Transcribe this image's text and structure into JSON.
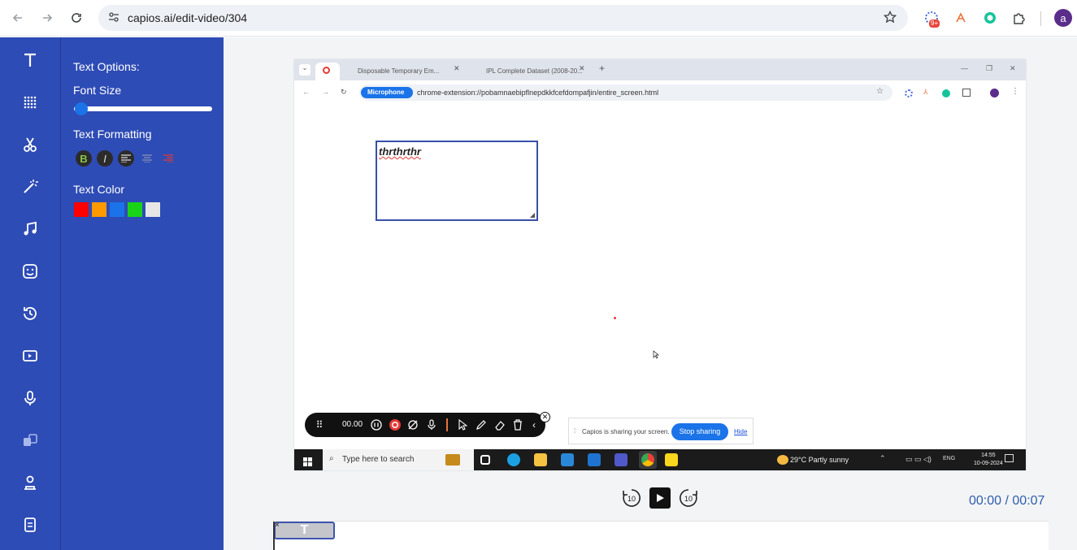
{
  "browser": {
    "url": "capios.ai/edit-video/304",
    "extension_badge": "9+",
    "avatar_letter": "a"
  },
  "rail": {
    "items": [
      "text-tool",
      "blur-tool",
      "cut-tool",
      "effects-tool",
      "music-tool",
      "sticker-tool",
      "speed-tool",
      "media-tool",
      "voice-tool",
      "transition-tool",
      "avatar-tool",
      "export-tool"
    ]
  },
  "panel": {
    "title": "Text Options:",
    "font_size_label": "Font Size",
    "font_size_level": 0.05,
    "formatting_label": "Text Formatting",
    "bold_label": "B",
    "italic_label": "I",
    "color_label": "Text Color",
    "colors": [
      "#ff0000",
      "#ff9900",
      "#1a73e8",
      "#19d319",
      "#e6e6e6"
    ]
  },
  "video": {
    "tab1": "Disposable Temporary Em...",
    "tab2": "IPL Complete Dataset (2008-20...",
    "mic_chip": "Microphone",
    "inner_url": "chrome-extension://pobamnaebipflnepdkkfcefdompafjin/entire_screen.html",
    "textbox_text": "thrthrthr",
    "timer": "00.00",
    "share_text": "Capios is sharing your screen.",
    "stop_label": "Stop sharing",
    "hide_label": "Hide",
    "search_placeholder": "Type here to search",
    "weather": "29°C  Partly sunny",
    "lang": "ENG",
    "clock_time": "14:55",
    "clock_date": "10-09-2024"
  },
  "playback": {
    "time_current": "00:00",
    "separator": " / ",
    "time_total": "00:07",
    "skip_back_label": "10",
    "skip_fwd_label": "10"
  },
  "timeline": {
    "clip_label": "T",
    "clip_close": "×"
  },
  "colors": {
    "sidebar": "#2e4cb5",
    "accent": "#1a73e8",
    "timecode": "#2e5eaa"
  }
}
